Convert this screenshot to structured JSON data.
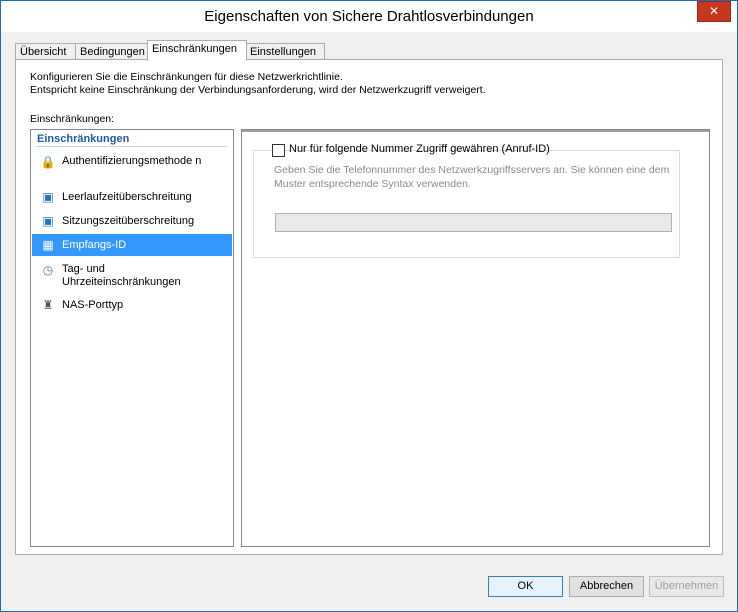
{
  "window": {
    "title": "Eigenschaften von Sichere Drahtlosverbindungen"
  },
  "tabs": [
    {
      "label": "Übersicht"
    },
    {
      "label": "Bedingungen"
    },
    {
      "label": "Einschränkungen"
    },
    {
      "label": "Einstellungen"
    }
  ],
  "active_tab": "Einschränkungen",
  "description": {
    "line1": "Konfigurieren Sie die Einschränkungen für diese Netzwerkrichtlinie.",
    "line2": "Entspricht keine Einschränkung der Verbindungsanforderung, wird der Netzwerkzugriff verweigert."
  },
  "restrictions_label": "Einschränkungen:",
  "restrictions_list": {
    "header": "Einschränkungen",
    "items": [
      {
        "label": "Authentifizierungsmethode n",
        "icon": "lock-icon"
      },
      {
        "label": "Leerlaufzeitüberschreitung",
        "icon": "idle-timeout-icon"
      },
      {
        "label": "Sitzungszeitüberschreitung",
        "icon": "session-timeout-icon"
      },
      {
        "label": "Empfangs-ID",
        "icon": "called-id-icon",
        "selected": true
      },
      {
        "label": "Tag- und Uhrzeiteinschränkungen",
        "icon": "clock-icon"
      },
      {
        "label": "NAS-Porttyp",
        "icon": "nas-port-icon"
      }
    ]
  },
  "called_id": {
    "checkbox_label": "Nur für folgende Nummer Zugriff gewähren (Anruf-ID)",
    "checked": false,
    "hint": "Geben Sie die Telefonnummer des Netzwerkzugriffsservers an. Sie können eine dem Muster entsprechende Syntax verwenden.",
    "phone_value": ""
  },
  "buttons": {
    "ok": "OK",
    "cancel": "Abbrechen",
    "apply": "Übernehmen"
  },
  "colors": {
    "selection": "#3399ff",
    "header": "#1e5aa8",
    "close": "#c7361e"
  }
}
